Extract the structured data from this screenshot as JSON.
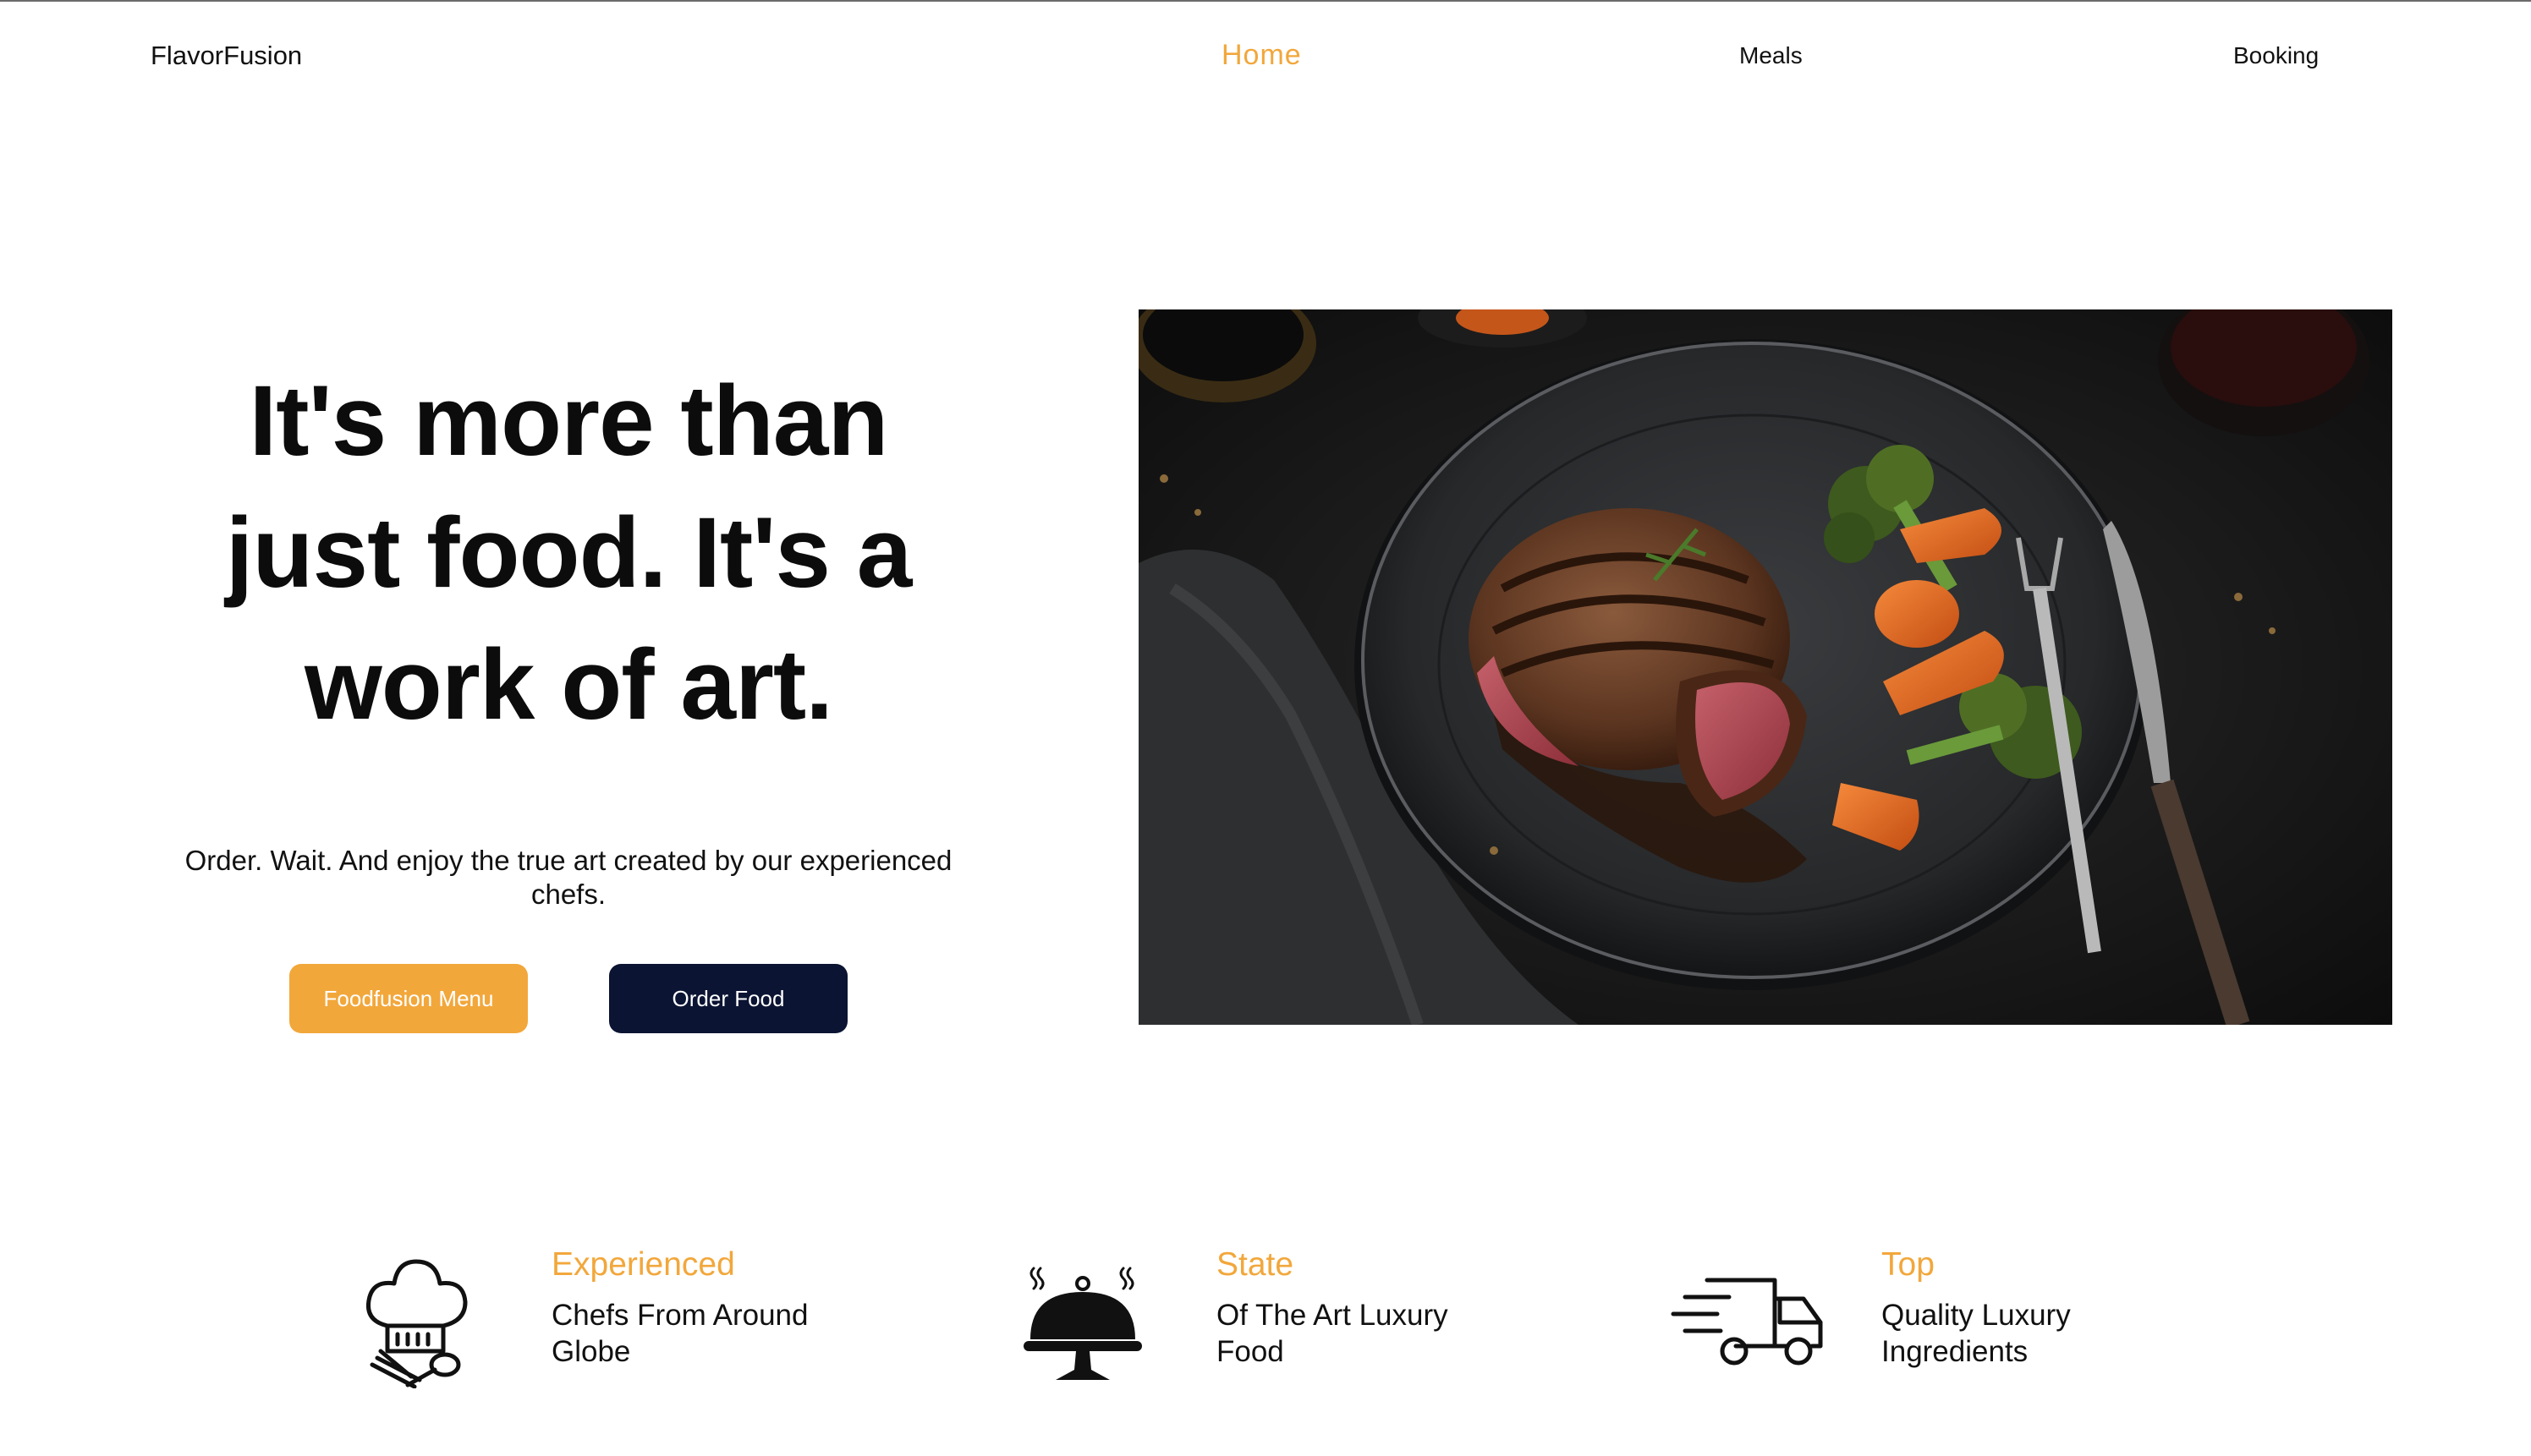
{
  "nav": {
    "brand": "FlavorFusion",
    "links": [
      {
        "label": "Home",
        "active": true
      },
      {
        "label": "Meals",
        "active": false
      },
      {
        "label": "Booking",
        "active": false
      }
    ]
  },
  "hero": {
    "title_lines": [
      "It's more than",
      "just food. It's a",
      "work of art."
    ],
    "subtitle": "Order. Wait. And enjoy the true art created by our experienced chefs.",
    "buttons": {
      "menu": "Foodfusion Menu",
      "order": "Order Food"
    },
    "image_icon": "steak-dinner-photo"
  },
  "features": [
    {
      "icon": "chef-hat-icon",
      "title": "Experienced",
      "desc": "Chefs From Around Globe"
    },
    {
      "icon": "cloche-icon",
      "title": "State",
      "desc": "Of The Art Luxury Food"
    },
    {
      "icon": "delivery-truck-icon",
      "title": "Top",
      "desc": "Quality Luxury Ingredients"
    }
  ],
  "colors": {
    "accent": "#f2a73b",
    "dark_button": "#0b1432",
    "text": "#111111",
    "background": "#ffffff"
  }
}
